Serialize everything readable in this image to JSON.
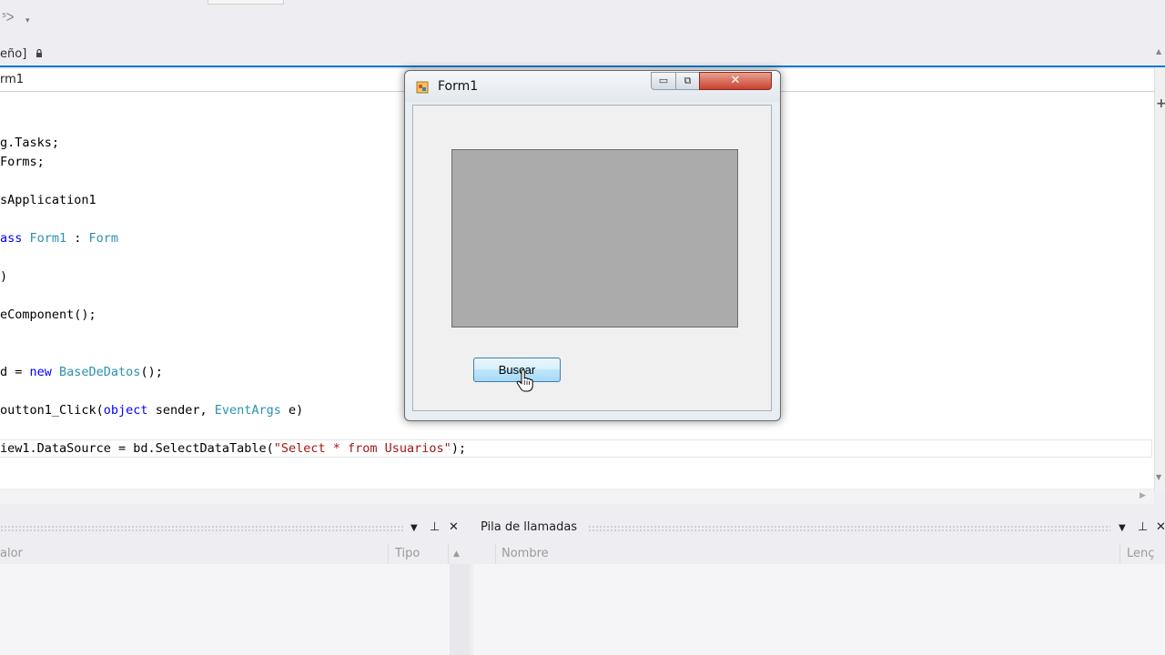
{
  "toolbar": {
    "glyph1": "⁵ᐳ",
    "glyph2": "▾"
  },
  "doc_tab": {
    "label": "eño]",
    "lock_icon": "lock-icon"
  },
  "navbar": {
    "class_label": "rm1"
  },
  "code": [
    [
      {
        "t": "g.Tasks;",
        "c": ""
      }
    ],
    [
      {
        "t": "Forms;",
        "c": ""
      }
    ],
    [],
    [
      {
        "t": "sApplication1",
        "c": ""
      }
    ],
    [],
    [
      {
        "t": "ass ",
        "c": "kw"
      },
      {
        "t": "Form1",
        "c": "ty"
      },
      {
        "t": " : ",
        "c": ""
      },
      {
        "t": "Form",
        "c": "ty"
      }
    ],
    [],
    [
      {
        "t": ")",
        "c": ""
      }
    ],
    [],
    [
      {
        "t": "eComponent();",
        "c": ""
      }
    ],
    [],
    [],
    [
      {
        "t": "d = ",
        "c": ""
      },
      {
        "t": "new ",
        "c": "kw"
      },
      {
        "t": "BaseDeDatos",
        "c": "ty"
      },
      {
        "t": "();",
        "c": ""
      }
    ],
    [],
    [
      {
        "t": "outton1_Click(",
        "c": ""
      },
      {
        "t": "object",
        "c": "kw"
      },
      {
        "t": " sender, ",
        "c": ""
      },
      {
        "t": "EventArgs",
        "c": "ty"
      },
      {
        "t": " e)",
        "c": ""
      }
    ],
    [],
    [
      {
        "t": "iew1.DataSource = bd.SelectDataTable(",
        "c": ""
      },
      {
        "t": "\"Select * from Usuarios\"",
        "c": "str"
      },
      {
        "t": ");",
        "c": ""
      }
    ]
  ],
  "form": {
    "title": "Form1",
    "minimize_symbol": "▭",
    "maximize_symbol": "⧉",
    "close_symbol": "✕",
    "button_label": "Buscar"
  },
  "left_panel": {
    "columns": [
      "alor",
      "Tipo"
    ],
    "controls": {
      "dropdown": "▼",
      "pin": "⊥",
      "close": "✕"
    }
  },
  "right_panel": {
    "title": "Pila de llamadas",
    "columns": [
      "Nombre",
      "Lenç"
    ],
    "controls": {
      "dropdown": "▼",
      "pin": "⊥",
      "close": "✕"
    }
  },
  "colors": {
    "accent": "#007acc",
    "keyword": "#0000ff",
    "type": "#2b91af",
    "string": "#a31515",
    "grid_bg": "#ababab"
  }
}
